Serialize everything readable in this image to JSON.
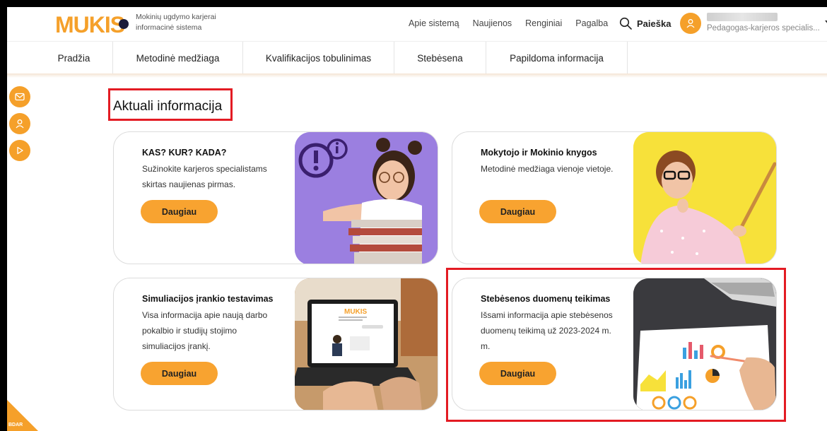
{
  "header": {
    "logo_text": "MUKIS",
    "logo_subtitle_line1": "Mokinių ugdymo karjerai",
    "logo_subtitle_line2": "informacinė sistema",
    "top_links": [
      "Apie sistemą",
      "Naujienos",
      "Renginiai",
      "Pagalba"
    ],
    "search_label": "Paieška",
    "user_role": "Pedagogas-karjeros specialis..."
  },
  "main_nav": [
    "Pradžia",
    "Metodinė medžiaga",
    "Kvalifikacijos tobulinimas",
    "Stebėsena",
    "Papildoma informacija"
  ],
  "side_buttons": [
    "mail-icon",
    "user-icon",
    "play-icon"
  ],
  "section": {
    "title": "Aktuali informacija"
  },
  "cards": [
    {
      "title": "KAS? KUR? KADA?",
      "desc": "Sužinokite karjeros specialistams skirtas naujienas pirmas.",
      "button": "Daugiau"
    },
    {
      "title": "Mokytojo ir Mokinio knygos",
      "desc": "Metodinė medžiaga vienoje vietoje.",
      "button": "Daugiau"
    },
    {
      "title": "Simuliacijos įrankio testavimas",
      "desc": "Visa informacija apie naują darbo pokalbio ir studijų stojimo simuliacijos įrankį.",
      "button": "Daugiau"
    },
    {
      "title": "Stebėsenos duomenų teikimas",
      "desc": "Išsami informacija apie stebėsenos duomenų teikimą už 2023-2024 m. m.",
      "button": "Daugiau"
    }
  ],
  "laptop_screen": {
    "logo": "MUKIS"
  },
  "corner_badge": "BDAR",
  "colors": {
    "accent": "#f5a02a",
    "button": "#f8a330",
    "highlight": "#e31b23",
    "purple_bg": "#9b7fe0",
    "yellow_bg": "#f7e13a"
  }
}
